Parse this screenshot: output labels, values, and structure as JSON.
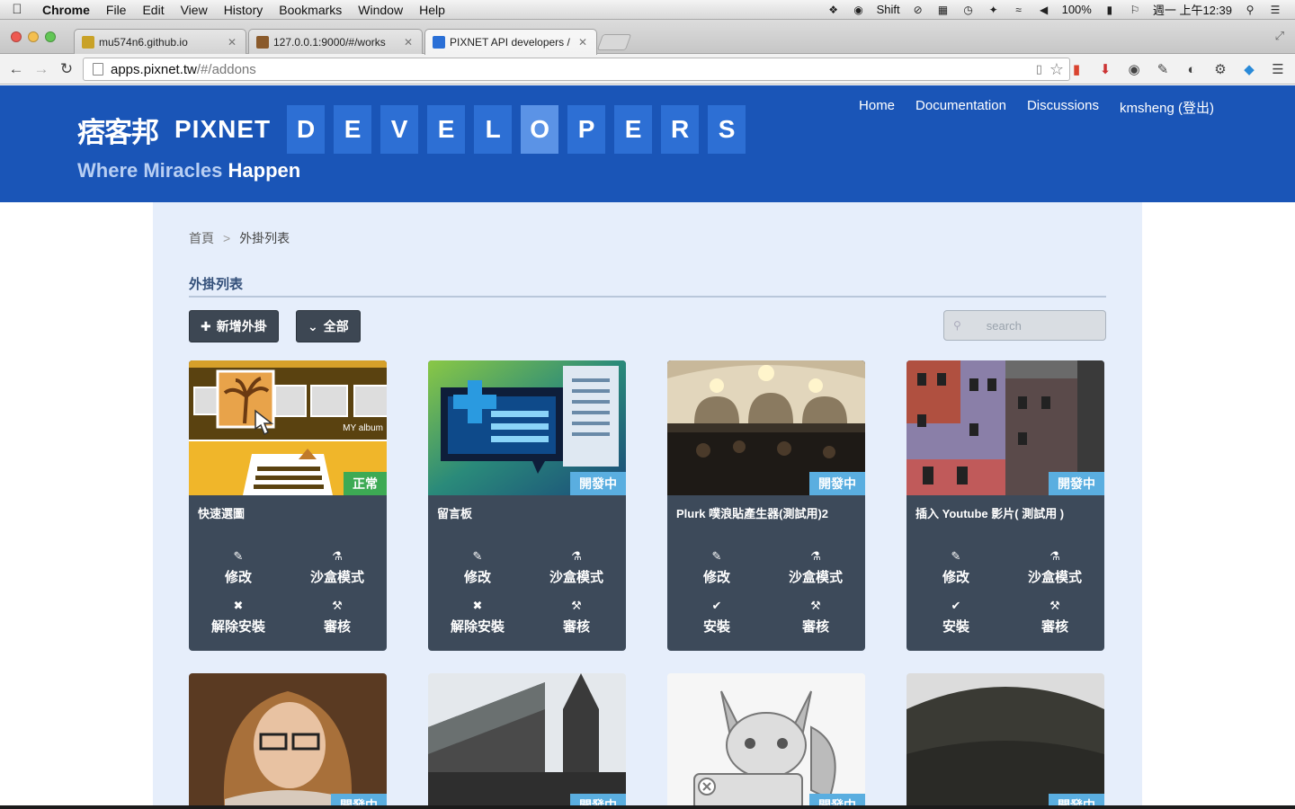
{
  "menubar": {
    "app": "Chrome",
    "items": [
      "File",
      "Edit",
      "View",
      "History",
      "Bookmarks",
      "Window",
      "Help"
    ],
    "shift": "Shift",
    "battery": "100%",
    "clock": "週一 上午12:39"
  },
  "tabs": [
    {
      "title": "mu574n6.github.io",
      "favicon_color": "#c9a227"
    },
    {
      "title": "127.0.0.1:9000/#/works",
      "favicon_color": "#8a5a2b"
    },
    {
      "title": "PIXNET API developers / M",
      "favicon_color": "#2a6fd6"
    }
  ],
  "address": {
    "host": "apps.pixnet.tw",
    "path": "/#/addons"
  },
  "header": {
    "logo_cjk": "痞客邦",
    "logo_text": "PIXNET",
    "developers_letters": [
      "D",
      "E",
      "V",
      "E",
      "L",
      "O",
      "P",
      "E",
      "R",
      "S"
    ],
    "tagline_soft": "Where Miracles",
    "tagline_strong": "Happen",
    "nav": [
      "Home",
      "Documentation",
      "Discussions",
      "kmsheng (登出)"
    ]
  },
  "breadcrumb": {
    "home": "首頁",
    "current": "外掛列表"
  },
  "section_title": "外掛列表",
  "buttons": {
    "add": "新增外掛",
    "filter": "全部"
  },
  "search": {
    "placeholder": "search"
  },
  "cards": [
    {
      "title": "快速選圖",
      "status": "正常",
      "status_type": "ok",
      "actions": [
        {
          "label": "修改",
          "icon": "pencil-icon"
        },
        {
          "label": "沙盒模式",
          "icon": "flask-icon"
        },
        {
          "label": "解除安裝",
          "icon": "cross-icon"
        },
        {
          "label": "審核",
          "icon": "gavel-icon"
        }
      ],
      "thumb_text": "MY album"
    },
    {
      "title": "留言板",
      "status": "開發中",
      "status_type": "dev",
      "actions": [
        {
          "label": "修改",
          "icon": "pencil-icon"
        },
        {
          "label": "沙盒模式",
          "icon": "flask-icon"
        },
        {
          "label": "解除安裝",
          "icon": "cross-icon"
        },
        {
          "label": "審核",
          "icon": "gavel-icon"
        }
      ]
    },
    {
      "title": "Plurk 噗浪貼產生器(測試用)2",
      "status": "開發中",
      "status_type": "dev",
      "actions": [
        {
          "label": "修改",
          "icon": "pencil-icon"
        },
        {
          "label": "沙盒模式",
          "icon": "flask-icon"
        },
        {
          "label": "安裝",
          "icon": "check-icon"
        },
        {
          "label": "審核",
          "icon": "gavel-icon"
        }
      ]
    },
    {
      "title": "插入 Youtube 影片( 測試用 )",
      "status": "開發中",
      "status_type": "dev",
      "actions": [
        {
          "label": "修改",
          "icon": "pencil-icon"
        },
        {
          "label": "沙盒模式",
          "icon": "flask-icon"
        },
        {
          "label": "安裝",
          "icon": "check-icon"
        },
        {
          "label": "審核",
          "icon": "gavel-icon"
        }
      ]
    }
  ],
  "row2_badges": [
    "開發中",
    "開發中",
    "開發中",
    "開發中"
  ]
}
